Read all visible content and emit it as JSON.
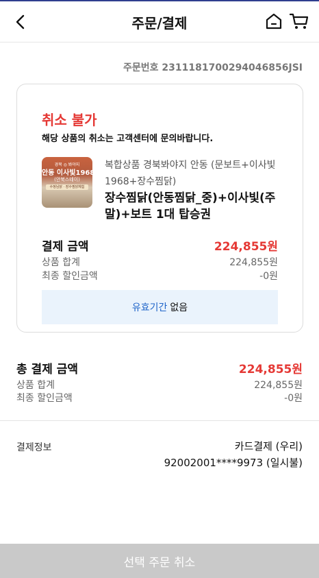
{
  "header": {
    "title": "주문/결제",
    "back_icon": "chevron-left-icon",
    "home_icon": "home-icon",
    "cart_icon": "cart-icon"
  },
  "order": {
    "number_text": "주문번호 2311181700294046856JSI"
  },
  "card": {
    "status_title": "취소 불가",
    "status_desc": "해당 상품의 취소는 고객센터에 문의바랍니다.",
    "thumbnail": {
      "line1": "경북 ◎ 봐야지",
      "line2": "안동 이사빛1968",
      "line3": "(안북스테이)",
      "line4": "수정님닭 · 장수찜닭체험"
    },
    "product_category": "복합상품  경북봐야지 안동 (문보트+이사빛1968+장수찜닭)",
    "product_name": "장수찜닭(안동찜닭_중)+이사빛(주말)+보트 1대 탑승권",
    "payment_label": "결제 금액",
    "payment_amount": "224,855원",
    "subtotal_label": "상품 합계",
    "subtotal_value": "224,855원",
    "discount_label": "최종 할인금액",
    "discount_value": "-0원",
    "validity_highlight": "유효기간",
    "validity_text": "없음"
  },
  "total": {
    "label": "총 결제 금액",
    "amount": "224,855원",
    "subtotal_label": "상품 합계",
    "subtotal_value": "224,855원",
    "discount_label": "최종 할인금액",
    "discount_value": "-0원"
  },
  "payment_info": {
    "label": "결제정보",
    "method": "카드결제 (우리)",
    "card": "92002001****9973 (일시불)"
  },
  "bottom_button": {
    "label": "선택 주문 취소"
  },
  "colors": {
    "accent_red": "#e53935",
    "link_blue": "#1f64c9",
    "validity_bg": "#eaf3fc",
    "disabled_button": "#c9c9c9"
  }
}
